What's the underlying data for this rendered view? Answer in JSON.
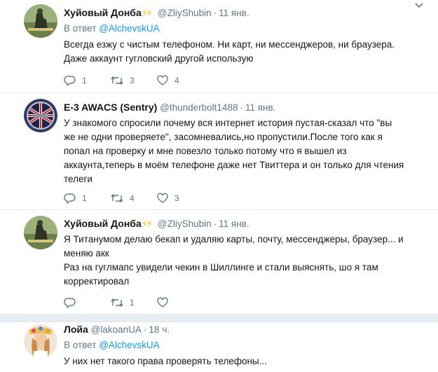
{
  "tweets": [
    {
      "name": "Хуйовый Донба",
      "name_suffix": "⚡⚡",
      "handle": "@ZliyShubin",
      "time": "11 янв.",
      "reply_prefix": "В ответ",
      "reply_mention": "@AlchevskUA",
      "lines": [
        "Всегда езжу с чистым телефоном. Ни карт, ни мессенджеров, ни браузера.",
        "Даже аккаунт гугловский другой использую"
      ],
      "replies": "1",
      "retweets": "3",
      "likes": "4"
    },
    {
      "name": "E-3 AWACS (Sentry)",
      "handle": "@thunderbolt1488",
      "time": "11 янв.",
      "lines": [
        "У знакомого спросили почему вся интернет история пустая-сказал что \"вы",
        "же не одни проверяете\", засомневались,но пропустили.После того как я",
        "попал на проверку и мне повезло только потому что я вышел из",
        "аккаунта,теперь в моём телефоне даже нет Твиттера и он только для чтения",
        "телеги"
      ],
      "replies": "1",
      "retweets": "4",
      "likes": "3"
    },
    {
      "name": "Хуйовый Донба",
      "name_suffix": "⚡⚡",
      "handle": "@ZliyShubin",
      "time": "11 янв.",
      "lines": [
        "Я Титанумом делаю бекап и удаляю карты, почту, мессенджеры, браузер... и",
        "меняю акк",
        "Раз на гуглмапс увидели чекин в Шиллинге и стали выяснять, шо я там",
        "корректировал"
      ],
      "replies": "",
      "retweets": "1",
      "likes": ""
    },
    {
      "name": "Лойа",
      "handle": "@lakoanUA",
      "time": "18 ч.",
      "reply_prefix": "В ответ",
      "reply_mention": "@AlchevskUA",
      "lines": [
        "У них нет такого права проверять телефоны..."
      ]
    }
  ]
}
